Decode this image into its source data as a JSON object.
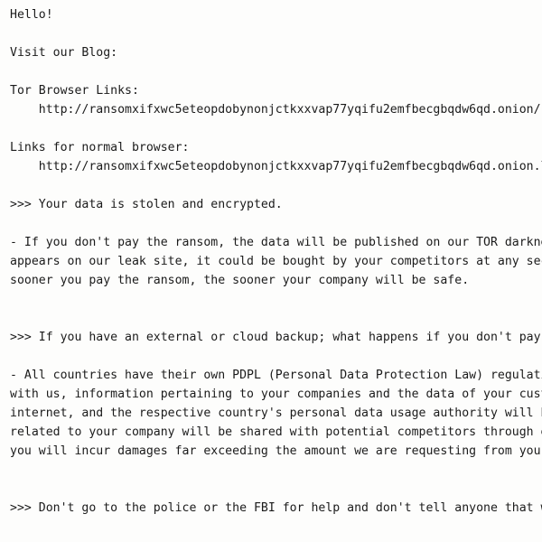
{
  "document": {
    "type": "plain-text-note",
    "font": "monospace",
    "text_color": "#1b1b1b",
    "background_color": "#fdfdfc",
    "clipped_right_edge": true,
    "lines": [
      {
        "id": "greeting",
        "text": "Hello!"
      },
      {
        "id": "blank-1",
        "text": ""
      },
      {
        "id": "visit-blog-heading",
        "text": "Visit our Blog:"
      },
      {
        "id": "blank-2",
        "text": ""
      },
      {
        "id": "tor-links-heading",
        "text": "Tor Browser Links:"
      },
      {
        "id": "tor-link-url",
        "text": "    http://ransomxifxwc5eteopdobynonjctkxxvap77yqifu2emfbecgbqdw6qd.onion/"
      },
      {
        "id": "blank-3",
        "text": ""
      },
      {
        "id": "normal-links-heading",
        "text": "Links for normal browser:"
      },
      {
        "id": "normal-link-url",
        "text": "    http://ransomxifxwc5eteopdobynonjctkxxvap77yqifu2emfbecgbqdw6qd.onion.ly/"
      },
      {
        "id": "blank-4",
        "text": ""
      },
      {
        "id": "stolen-heading",
        "text": ">>> Your data is stolen and encrypted."
      },
      {
        "id": "blank-5",
        "text": ""
      },
      {
        "id": "ransom-para-line-1",
        "text": "- If you don't pay the ransom, the data will be published on our TOR darknet sites. Keep in mind that once your data"
      },
      {
        "id": "ransom-para-line-2",
        "text": "appears on our leak site, it could be bought by your competitors at any second, so don't hesitate for a long time. The"
      },
      {
        "id": "ransom-para-line-3",
        "text": "sooner you pay the ransom, the sooner your company will be safe."
      },
      {
        "id": "blank-6",
        "text": ""
      },
      {
        "id": "blank-7",
        "text": ""
      },
      {
        "id": "backup-heading",
        "text": ">>> If you have an external or cloud backup; what happens if you don't pay?"
      },
      {
        "id": "blank-8",
        "text": ""
      },
      {
        "id": "pdpl-para-line-1",
        "text": "- All countries have their own PDPL (Personal Data Protection Law) regulations. If you do not want to cooperate"
      },
      {
        "id": "pdpl-para-line-2",
        "text": "with us, information pertaining to your companies and the data of your customers will be published on the"
      },
      {
        "id": "pdpl-para-line-3",
        "text": "internet, and the respective country's personal data usage authority will be notified. In addition, all data"
      },
      {
        "id": "pdpl-para-line-4",
        "text": "related to your company will be shared with potential competitors through e-mail and social media. As a result,"
      },
      {
        "id": "pdpl-para-line-5",
        "text": "you will incur damages far exceeding the amount we are requesting from you."
      },
      {
        "id": "blank-9",
        "text": ""
      },
      {
        "id": "blank-10",
        "text": ""
      },
      {
        "id": "police-heading",
        "text": ">>> Don't go to the police or the FBI for help and don't tell anyone that we attacked you."
      }
    ]
  }
}
